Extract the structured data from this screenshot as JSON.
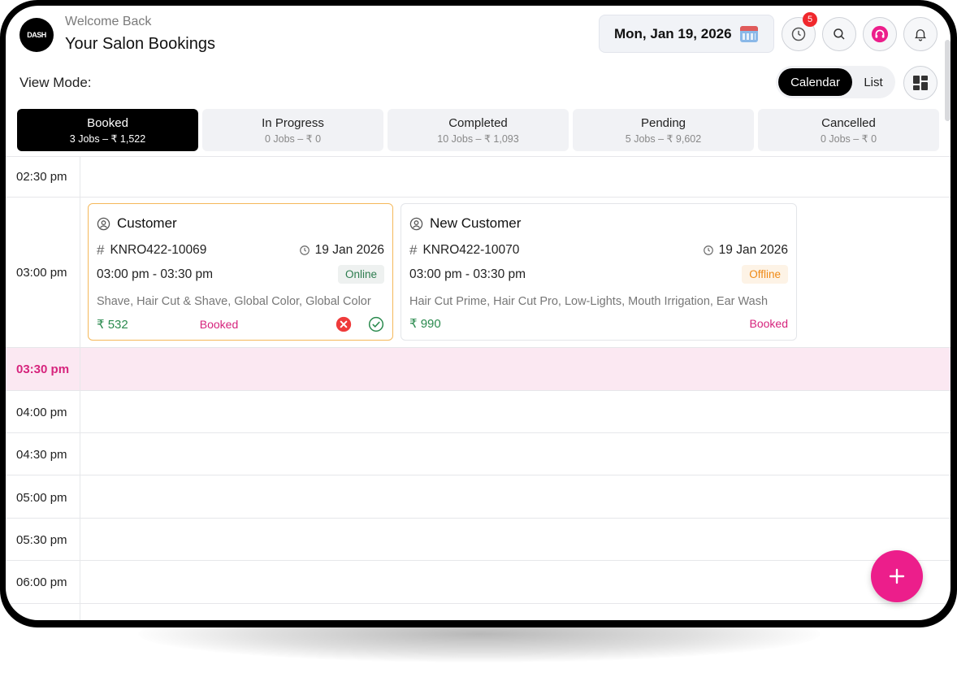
{
  "header": {
    "logo_text": "DASH",
    "welcome": "Welcome Back",
    "title": "Your Salon Bookings",
    "date": "Mon, Jan 19, 2026",
    "history_badge": "5"
  },
  "view": {
    "label": "View Mode:",
    "calendar": "Calendar",
    "list": "List"
  },
  "tabs": [
    {
      "label": "Booked",
      "summary": "3 Jobs – ₹ 1,522"
    },
    {
      "label": "In Progress",
      "summary": "0 Jobs – ₹ 0"
    },
    {
      "label": "Completed",
      "summary": "10 Jobs – ₹ 1,093"
    },
    {
      "label": "Pending",
      "summary": "5 Jobs – ₹ 9,602"
    },
    {
      "label": "Cancelled",
      "summary": "0 Jobs – ₹ 0"
    }
  ],
  "slots": [
    "02:30 pm",
    "03:00 pm",
    "03:30 pm",
    "04:00 pm",
    "04:30 pm",
    "05:00 pm",
    "05:30 pm",
    "06:00 pm"
  ],
  "bookings": [
    {
      "name": "Customer",
      "id": "KNRO422-10069",
      "date": "19 Jan 2026",
      "time": "03:00 pm - 03:30 pm",
      "mode": "Online",
      "services": "Shave, Hair Cut & Shave, Global Color, Global Color",
      "price": "₹ 532",
      "status": "Booked"
    },
    {
      "name": "New Customer",
      "id": "KNRO422-10070",
      "date": "19 Jan 2026",
      "time": "03:00 pm - 03:30 pm",
      "mode": "Offline",
      "services": "Hair Cut Prime, Hair Cut Pro, Low-Lights, Mouth Irrigation, Ear Wash",
      "price": "₹ 990",
      "status": "Booked"
    }
  ],
  "icons": {
    "history": "history-icon",
    "search": "search-icon",
    "support": "headset-icon",
    "notifications": "bell-icon",
    "layout": "grid-layout-icon",
    "add": "plus-icon",
    "calendar": "calendar-icon"
  },
  "colors": {
    "accent": "#ec1e8b",
    "success": "#2a8a4e",
    "warning": "#ef8a16",
    "danger": "#ef3b3b"
  }
}
